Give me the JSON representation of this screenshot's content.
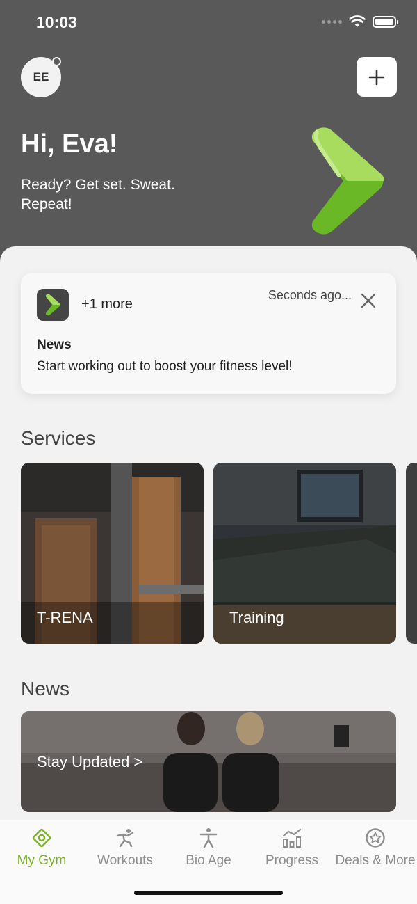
{
  "status_bar": {
    "time": "10:03"
  },
  "header": {
    "avatar_initials": "EE",
    "greeting": "Hi, Eva!",
    "tagline": "Ready? Get set. Sweat. Repeat!"
  },
  "notification": {
    "more": "+1 more",
    "time": "Seconds ago...",
    "title": "News",
    "body": "Start working out to boost your fitness level!"
  },
  "services": {
    "title": "Services",
    "items": [
      {
        "label": "T-RENA"
      },
      {
        "label": "Training"
      }
    ]
  },
  "news": {
    "title": "News",
    "card_label": "Stay Updated >"
  },
  "tabbar": {
    "items": [
      {
        "label": "My Gym",
        "icon": "gym-icon",
        "active": true
      },
      {
        "label": "Workouts",
        "icon": "workouts-icon"
      },
      {
        "label": "Bio Age",
        "icon": "bio-age-icon"
      },
      {
        "label": "Progress",
        "icon": "progress-icon"
      },
      {
        "label": "Deals & More",
        "icon": "deals-icon"
      }
    ]
  },
  "colors": {
    "accent": "#7cb22a",
    "header_bg": "#595959",
    "background": "#f2f2f2"
  }
}
